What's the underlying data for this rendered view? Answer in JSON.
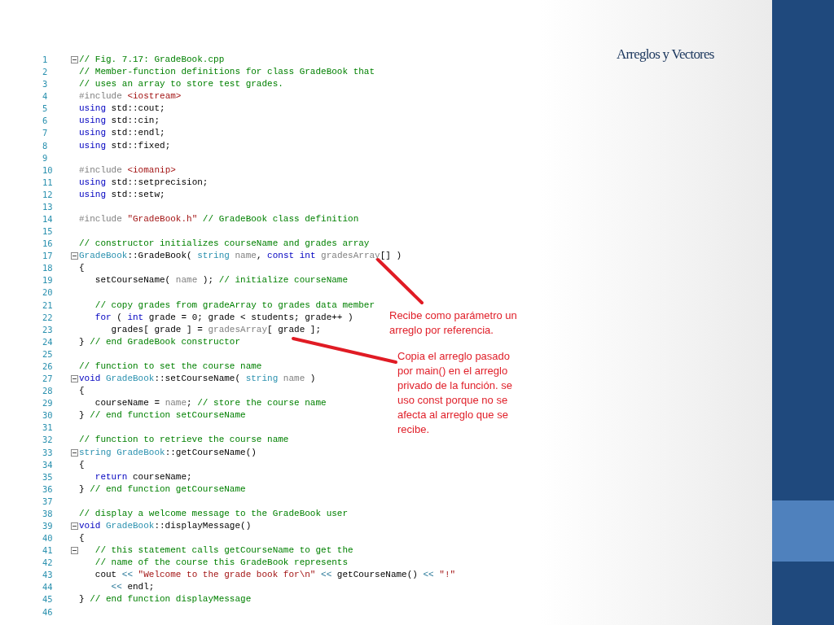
{
  "slide_title": "Arreglos y Vectores",
  "code_lines": [
    {
      "number": "1",
      "fold": true,
      "tokens": [
        {
          "kind": "comment",
          "text": "// Fig. 7.17: GradeBook.cpp"
        }
      ]
    },
    {
      "number": "2",
      "fold": false,
      "tokens": [
        {
          "kind": "comment",
          "text": "// Member-function definitions for class GradeBook that"
        }
      ]
    },
    {
      "number": "3",
      "fold": false,
      "tokens": [
        {
          "kind": "comment",
          "text": "// uses an array to store test grades."
        }
      ]
    },
    {
      "number": "4",
      "fold": false,
      "tokens": [
        {
          "kind": "preproc",
          "text": "#include "
        },
        {
          "kind": "string",
          "text": "<iostream>"
        }
      ]
    },
    {
      "number": "5",
      "fold": false,
      "tokens": [
        {
          "kind": "keyword",
          "text": "using"
        },
        {
          "kind": "plain",
          "text": " std::cout;"
        }
      ]
    },
    {
      "number": "6",
      "fold": false,
      "tokens": [
        {
          "kind": "keyword",
          "text": "using"
        },
        {
          "kind": "plain",
          "text": " std::cin;"
        }
      ]
    },
    {
      "number": "7",
      "fold": false,
      "tokens": [
        {
          "kind": "keyword",
          "text": "using"
        },
        {
          "kind": "plain",
          "text": " std::endl;"
        }
      ]
    },
    {
      "number": "8",
      "fold": false,
      "tokens": [
        {
          "kind": "keyword",
          "text": "using"
        },
        {
          "kind": "plain",
          "text": " std::fixed;"
        }
      ]
    },
    {
      "number": "9",
      "fold": false
    },
    {
      "number": "10",
      "fold": false,
      "tokens": [
        {
          "kind": "preproc",
          "text": "#include "
        },
        {
          "kind": "string",
          "text": "<iomanip>"
        }
      ]
    },
    {
      "number": "11",
      "fold": false,
      "tokens": [
        {
          "kind": "keyword",
          "text": "using"
        },
        {
          "kind": "plain",
          "text": " std::setprecision;"
        }
      ]
    },
    {
      "number": "12",
      "fold": false,
      "tokens": [
        {
          "kind": "keyword",
          "text": "using"
        },
        {
          "kind": "plain",
          "text": " std::setw;"
        }
      ]
    },
    {
      "number": "13",
      "fold": false
    },
    {
      "number": "14",
      "fold": false,
      "tokens": [
        {
          "kind": "preproc",
          "text": "#include "
        },
        {
          "kind": "string",
          "text": "\"GradeBook.h\""
        },
        {
          "kind": "comment",
          "text": " // GradeBook class definition"
        }
      ]
    },
    {
      "number": "15",
      "fold": false
    },
    {
      "number": "16",
      "fold": false,
      "tokens": [
        {
          "kind": "comment",
          "text": "// constructor initializes courseName and grades array"
        }
      ]
    },
    {
      "number": "17",
      "fold": true,
      "tokens": [
        {
          "kind": "type",
          "text": "GradeBook"
        },
        {
          "kind": "plain",
          "text": "::GradeBook( "
        },
        {
          "kind": "type",
          "text": "string"
        },
        {
          "kind": "param",
          "text": " name"
        },
        {
          "kind": "plain",
          "text": ", "
        },
        {
          "kind": "keyword",
          "text": "const int"
        },
        {
          "kind": "param",
          "text": " gradesArray"
        },
        {
          "kind": "plain",
          "text": "[] )"
        }
      ]
    },
    {
      "number": "18",
      "fold": false,
      "tokens": [
        {
          "kind": "plain",
          "text": "{"
        }
      ]
    },
    {
      "number": "19",
      "fold": false,
      "tokens": [
        {
          "kind": "plain",
          "text": "   setCourseName( "
        },
        {
          "kind": "param",
          "text": "name"
        },
        {
          "kind": "plain",
          "text": " ); "
        },
        {
          "kind": "comment",
          "text": "// initialize courseName"
        }
      ]
    },
    {
      "number": "20",
      "fold": false
    },
    {
      "number": "21",
      "fold": false,
      "tokens": [
        {
          "kind": "comment",
          "text": "   // copy grades from gradeArray to grades data member"
        }
      ]
    },
    {
      "number": "22",
      "fold": false,
      "tokens": [
        {
          "kind": "keyword",
          "text": "   for"
        },
        {
          "kind": "plain",
          "text": " ( "
        },
        {
          "kind": "keyword",
          "text": "int"
        },
        {
          "kind": "plain",
          "text": " grade = 0; grade < students; grade++ )"
        }
      ]
    },
    {
      "number": "23",
      "fold": false,
      "tokens": [
        {
          "kind": "plain",
          "text": "      grades[ grade ] = "
        },
        {
          "kind": "param",
          "text": "gradesArray"
        },
        {
          "kind": "plain",
          "text": "[ grade ];"
        }
      ]
    },
    {
      "number": "24",
      "fold": false,
      "tokens": [
        {
          "kind": "plain",
          "text": "} "
        },
        {
          "kind": "comment",
          "text": "// end GradeBook constructor"
        }
      ]
    },
    {
      "number": "25",
      "fold": false
    },
    {
      "number": "26",
      "fold": false,
      "tokens": [
        {
          "kind": "comment",
          "text": "// function to set the course name"
        }
      ]
    },
    {
      "number": "27",
      "fold": true,
      "tokens": [
        {
          "kind": "keyword",
          "text": "void"
        },
        {
          "kind": "type",
          "text": " GradeBook"
        },
        {
          "kind": "plain",
          "text": "::setCourseName( "
        },
        {
          "kind": "type",
          "text": "string"
        },
        {
          "kind": "param",
          "text": " name"
        },
        {
          "kind": "plain",
          "text": " )"
        }
      ]
    },
    {
      "number": "28",
      "fold": false,
      "tokens": [
        {
          "kind": "plain",
          "text": "{"
        }
      ]
    },
    {
      "number": "29",
      "fold": false,
      "tokens": [
        {
          "kind": "plain",
          "text": "   courseName = "
        },
        {
          "kind": "param",
          "text": "name"
        },
        {
          "kind": "plain",
          "text": "; "
        },
        {
          "kind": "comment",
          "text": "// store the course name"
        }
      ]
    },
    {
      "number": "30",
      "fold": false,
      "tokens": [
        {
          "kind": "plain",
          "text": "} "
        },
        {
          "kind": "comment",
          "text": "// end function setCourseName"
        }
      ]
    },
    {
      "number": "31",
      "fold": false
    },
    {
      "number": "32",
      "fold": false,
      "tokens": [
        {
          "kind": "comment",
          "text": "// function to retrieve the course name"
        }
      ]
    },
    {
      "number": "33",
      "fold": true,
      "tokens": [
        {
          "kind": "type",
          "text": "string GradeBook"
        },
        {
          "kind": "plain",
          "text": "::getCourseName()"
        }
      ]
    },
    {
      "number": "34",
      "fold": false,
      "tokens": [
        {
          "kind": "plain",
          "text": "{"
        }
      ]
    },
    {
      "number": "35",
      "fold": false,
      "tokens": [
        {
          "kind": "keyword",
          "text": "   return"
        },
        {
          "kind": "plain",
          "text": " courseName;"
        }
      ]
    },
    {
      "number": "36",
      "fold": false,
      "tokens": [
        {
          "kind": "plain",
          "text": "} "
        },
        {
          "kind": "comment",
          "text": "// end function getCourseName"
        }
      ]
    },
    {
      "number": "37",
      "fold": false
    },
    {
      "number": "38",
      "fold": false,
      "tokens": [
        {
          "kind": "comment",
          "text": "// display a welcome message to the GradeBook user"
        }
      ]
    },
    {
      "number": "39",
      "fold": true,
      "tokens": [
        {
          "kind": "keyword",
          "text": "void"
        },
        {
          "kind": "type",
          "text": " GradeBook"
        },
        {
          "kind": "plain",
          "text": "::displayMessage()"
        }
      ]
    },
    {
      "number": "40",
      "fold": false,
      "tokens": [
        {
          "kind": "plain",
          "text": "{"
        }
      ]
    },
    {
      "number": "41",
      "fold": true,
      "tokens": [
        {
          "kind": "comment",
          "text": "   // this statement calls getCourseName to get the"
        }
      ]
    },
    {
      "number": "42",
      "fold": false,
      "tokens": [
        {
          "kind": "comment",
          "text": "   // name of the course this GradeBook represents"
        }
      ]
    },
    {
      "number": "43",
      "fold": false,
      "tokens": [
        {
          "kind": "plain",
          "text": "   cout "
        },
        {
          "kind": "operator",
          "text": "<<"
        },
        {
          "kind": "string",
          "text": " \"Welcome to the grade book for\\n\""
        },
        {
          "kind": "operator",
          "text": " <<"
        },
        {
          "kind": "plain",
          "text": " getCourseName() "
        },
        {
          "kind": "operator",
          "text": "<<"
        },
        {
          "kind": "string",
          "text": " \"!\""
        }
      ]
    },
    {
      "number": "44",
      "fold": false,
      "tokens": [
        {
          "kind": "operator",
          "text": "      <<"
        },
        {
          "kind": "plain",
          "text": " endl;"
        }
      ]
    },
    {
      "number": "45",
      "fold": false,
      "tokens": [
        {
          "kind": "plain",
          "text": "} "
        },
        {
          "kind": "comment",
          "text": "// end function displayMessage"
        }
      ]
    },
    {
      "number": "46",
      "fold": false
    }
  ],
  "annotations": [
    {
      "text": "Recibe como parámetro un arreglo por referencia.",
      "kind": "receive"
    },
    {
      "text": "Copia el arreglo pasado por main() en el arreglo privado de la función. se uso const porque no se afecta al arreglo que se recibe.",
      "kind": "copy"
    }
  ]
}
